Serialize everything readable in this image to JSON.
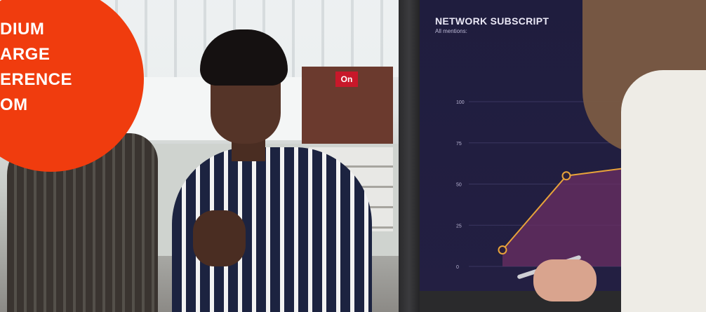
{
  "badge": {
    "lines": [
      "DIUM",
      "ARGE",
      "ERENCE",
      "OM"
    ],
    "color": "#f03c0e"
  },
  "office": {
    "sign_text": "On"
  },
  "screen": {
    "title": "NETWORK SUBSCRIPT",
    "subtitle": "All mentions:"
  },
  "chart_data": {
    "type": "area",
    "title": "NETWORK SUBSCRIPT",
    "subtitle": "All mentions:",
    "y_ticks": [
      "100",
      "75",
      "50",
      "25",
      "0"
    ],
    "ylim": [
      0,
      100
    ],
    "series": [
      {
        "values": [
          10,
          55,
          60
        ]
      }
    ],
    "line_color": "#e8a33a",
    "area_color": "#6b2f63"
  }
}
